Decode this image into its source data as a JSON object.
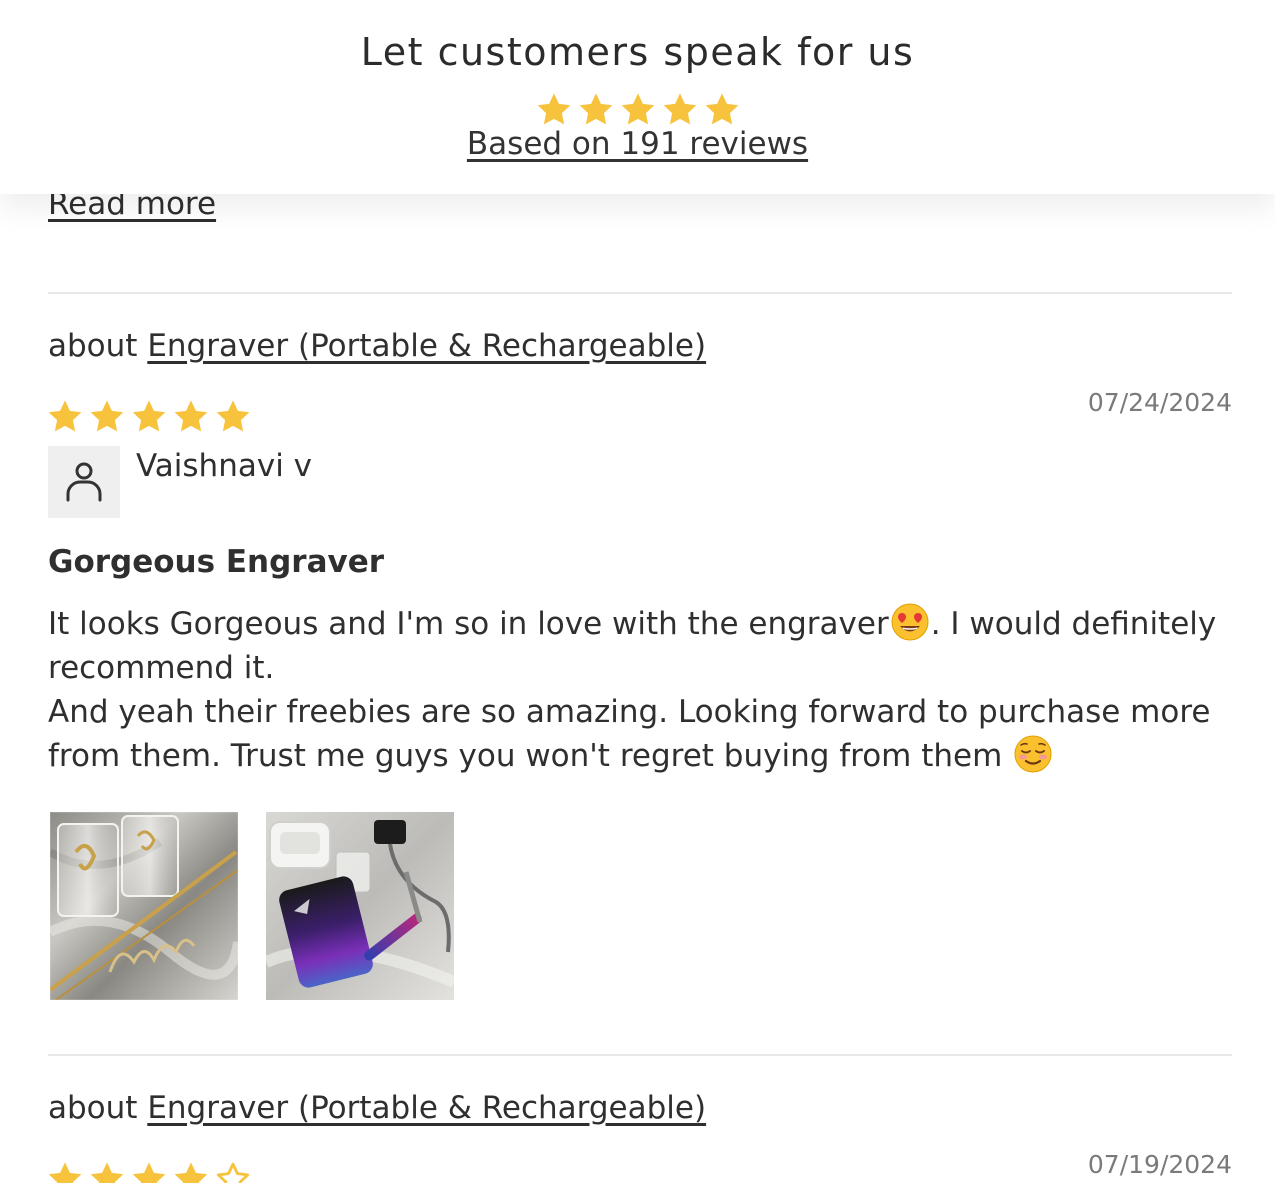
{
  "header": {
    "title": "Let customers speak for us",
    "rating_stars": 5,
    "reviews_link": "Based on 191 reviews"
  },
  "previous_review": {
    "read_more_label": "Read more"
  },
  "reviews": [
    {
      "about_prefix": "about",
      "product": "Engraver (Portable & Rechargeable)",
      "date": "07/24/2024",
      "rating": 5,
      "reviewer": "Vaishnavi v",
      "title": "Gorgeous Engraver",
      "body": {
        "line1_before_emoji": "It looks Gorgeous and I'm so in love with the engraver",
        "line1_after_emoji": ". I would definitely",
        "line2": "recommend it.",
        "line3": "And yeah their freebies are so amazing. Looking forward to purchase more",
        "line4": "from them. Trust me guys you won't regret buying from them"
      },
      "photos": [
        "engraved-glasses-photo",
        "engraver-kit-photo"
      ]
    },
    {
      "about_prefix": "about",
      "product": "Engraver (Portable & Rechargeable)",
      "date": "07/19/2024",
      "rating": 4
    }
  ],
  "colors": {
    "star_fill": "#F8C33C",
    "text": "#2F2F2F",
    "date": "#7A7A7A",
    "divider": "#E8E8E8",
    "avatar_bg": "#EFEFEF"
  },
  "icons": {
    "star": "star-icon",
    "user": "user-icon",
    "heart_eyes": "heart-eyes-emoji",
    "smiling": "smiling-face-emoji"
  }
}
